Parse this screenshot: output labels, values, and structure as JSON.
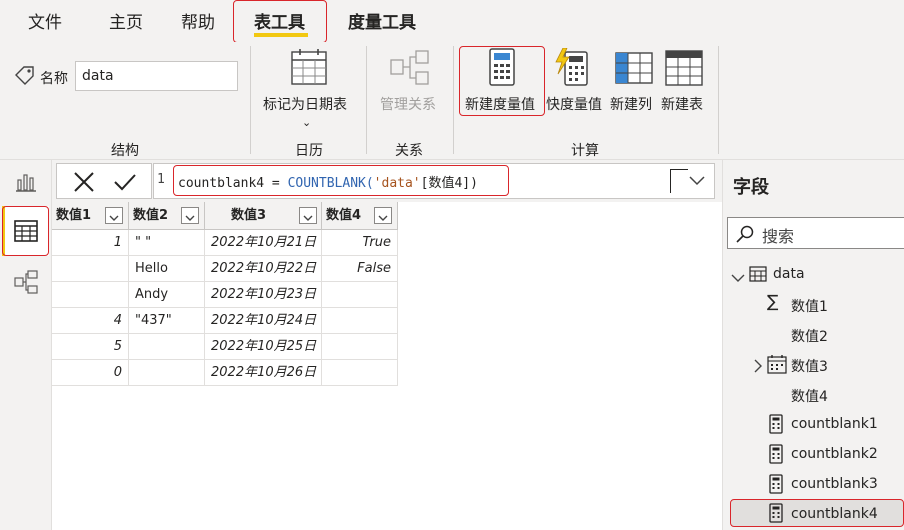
{
  "menu": {
    "tabs": [
      {
        "label": "文件"
      },
      {
        "label": "主页"
      },
      {
        "label": "帮助"
      },
      {
        "label": "表工具"
      },
      {
        "label": "度量工具"
      }
    ]
  },
  "ribbon": {
    "structure": {
      "name_label": "名称",
      "name_value": "data",
      "group_label": "结构"
    },
    "calendar": {
      "mark_date_label": "标记为日期表",
      "group_label": "日历"
    },
    "relations": {
      "manage_label": "管理关系",
      "group_label": "关系"
    },
    "calc": {
      "new_measure": "新建度量值",
      "quick_measure": "快度量值",
      "new_column": "新建列",
      "new_table": "新建表",
      "group_label": "计算"
    }
  },
  "formula": {
    "line_number": "1",
    "text_name": "countblank4 = ",
    "text_func": "COUNTBLANK(",
    "text_table": "'data'",
    "text_col": "[数值4]",
    "text_close": ")"
  },
  "table": {
    "headers": [
      "数值1",
      "数值2",
      "数值3",
      "数值4"
    ],
    "rows": [
      [
        "1",
        "\" \"",
        "2022年10月21日",
        "True"
      ],
      [
        "",
        "Hello",
        "2022年10月22日",
        "False"
      ],
      [
        "",
        "Andy",
        "2022年10月23日",
        ""
      ],
      [
        "4",
        "\"437\"",
        "2022年10月24日",
        ""
      ],
      [
        "5",
        "",
        "2022年10月25日",
        ""
      ],
      [
        "0",
        "",
        "2022年10月26日",
        ""
      ]
    ]
  },
  "fields": {
    "title": "字段",
    "search_placeholder": "搜索",
    "table_name": "data",
    "items": [
      "数值1",
      "数值2",
      "数值3",
      "数值4",
      "countblank1",
      "countblank2",
      "countblank3",
      "countblank4"
    ]
  },
  "colors": {
    "accent": "#f2c811",
    "highlight": "#d9262b"
  }
}
